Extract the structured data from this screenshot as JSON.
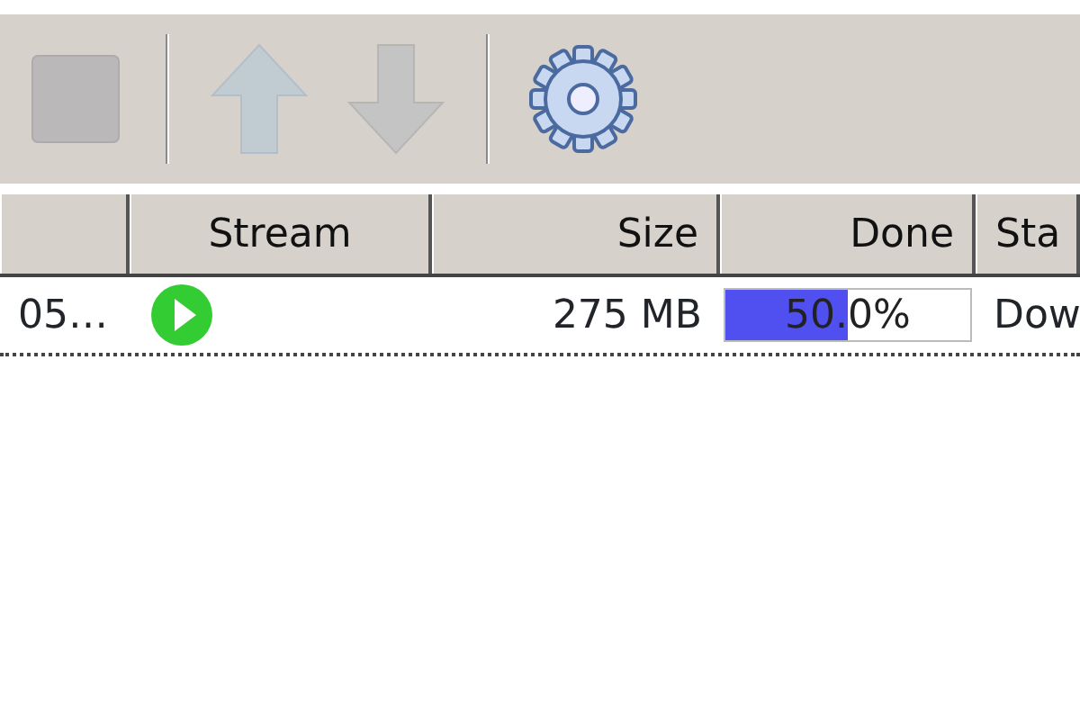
{
  "toolbar": [
    {
      "kind": "stop",
      "disabled": true
    },
    {
      "kind": "separator"
    },
    {
      "kind": "up",
      "disabled": true
    },
    {
      "kind": "down",
      "disabled": true
    },
    {
      "kind": "separator"
    },
    {
      "kind": "settings",
      "disabled": false
    }
  ],
  "table": {
    "columns": [
      {
        "label": "Stream"
      },
      {
        "label": "Size"
      },
      {
        "label": "Done"
      },
      {
        "label": "Sta"
      }
    ],
    "rows": [
      {
        "name": "05…",
        "streamable": true,
        "size": "275 MB",
        "done": "50.0%",
        "level": 0.5,
        "status": "Dow"
      }
    ]
  }
}
